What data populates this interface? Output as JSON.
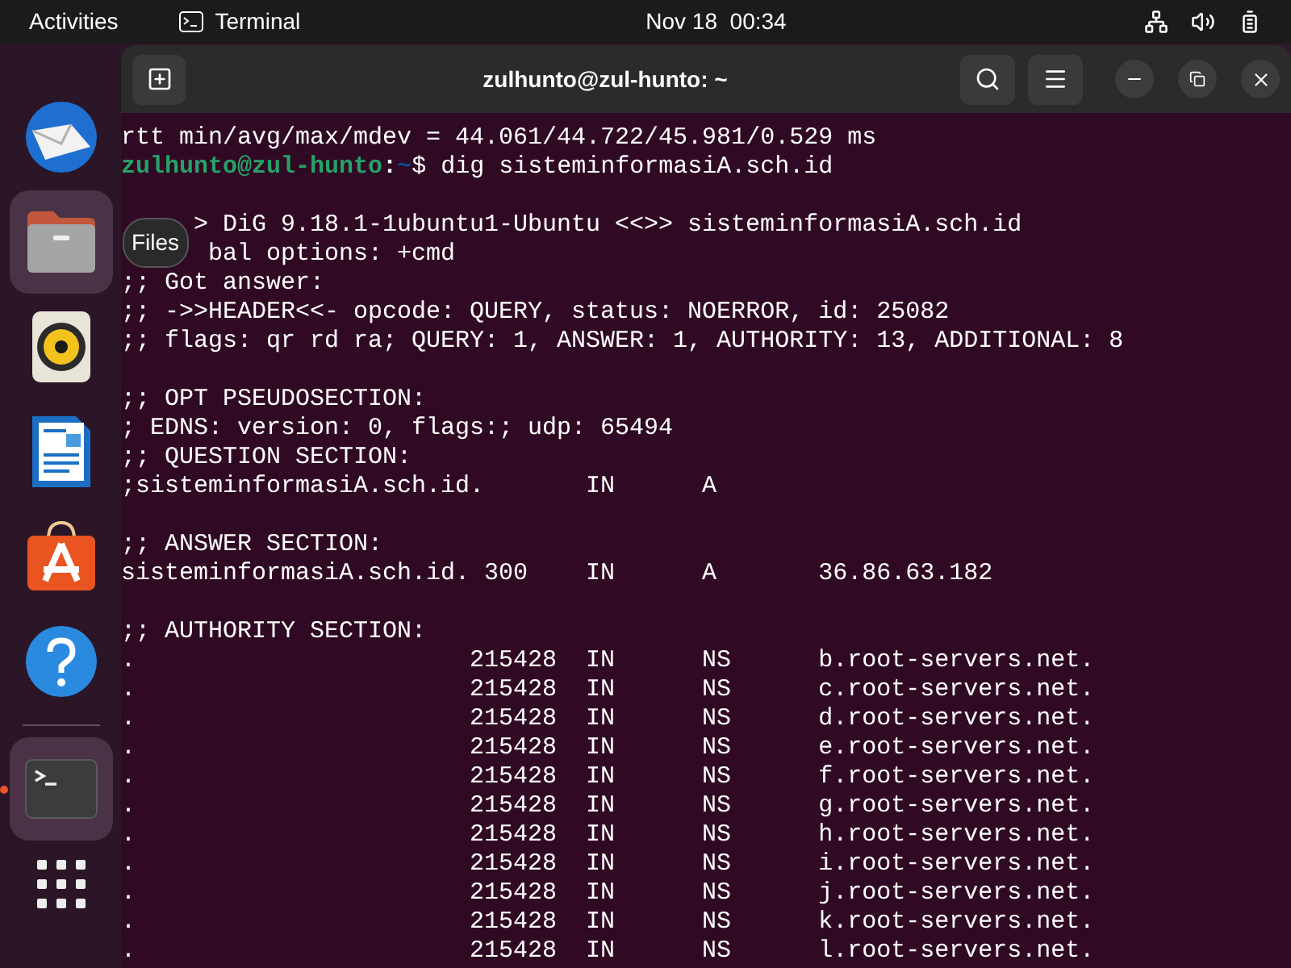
{
  "top_bar": {
    "activities": "Activities",
    "app_name": "Terminal",
    "clock": "Nov 18  00:34"
  },
  "dock": {
    "items": [
      {
        "kind": "mail",
        "running": false,
        "highlighted": false
      },
      {
        "kind": "files",
        "running": false,
        "highlighted": true
      },
      {
        "kind": "music",
        "running": false,
        "highlighted": false
      },
      {
        "kind": "writer",
        "running": false,
        "highlighted": false
      },
      {
        "kind": "store",
        "running": false,
        "highlighted": false
      },
      {
        "kind": "help",
        "running": false,
        "highlighted": false
      },
      {
        "kind": "separator"
      },
      {
        "kind": "terminal",
        "running": true,
        "highlighted": true
      },
      {
        "kind": "apps"
      }
    ],
    "tooltip": "Files"
  },
  "window": {
    "title": "zulhunto@zul-hunto: ~"
  },
  "terminal": {
    "lines": [
      {
        "kind": "output",
        "text": "rtt min/avg/max/mdev = 44.061/44.722/45.981/0.529 ms"
      },
      {
        "kind": "prompt",
        "user_host": "zulhunto@zul-hunto",
        "separator": ":",
        "path": "~",
        "command": "$ dig sisteminformasiA.sch.id"
      },
      {
        "kind": "blank"
      },
      {
        "kind": "covered_short",
        "text": "> DiG 9.18.1-1ubuntu1-Ubuntu <<>> sisteminformasiA.sch.id"
      },
      {
        "kind": "covered_long",
        "text": "bal options: +cmd"
      },
      {
        "kind": "output",
        "text": ";; Got answer:"
      },
      {
        "kind": "output",
        "text": ";; ->>HEADER<<- opcode: QUERY, status: NOERROR, id: 25082"
      },
      {
        "kind": "output",
        "text": ";; flags: qr rd ra; QUERY: 1, ANSWER: 1, AUTHORITY: 13, ADDITIONAL: 8"
      },
      {
        "kind": "blank"
      },
      {
        "kind": "output",
        "text": ";; OPT PSEUDOSECTION:"
      },
      {
        "kind": "output",
        "text": "; EDNS: version: 0, flags:; udp: 65494"
      },
      {
        "kind": "output",
        "text": ";; QUESTION SECTION:"
      },
      {
        "kind": "output",
        "text": ";sisteminformasiA.sch.id.       IN      A"
      },
      {
        "kind": "blank"
      },
      {
        "kind": "output",
        "text": ";; ANSWER SECTION:"
      },
      {
        "kind": "output",
        "text": "sisteminformasiA.sch.id. 300    IN      A       36.86.63.182"
      },
      {
        "kind": "blank"
      },
      {
        "kind": "output",
        "text": ";; AUTHORITY SECTION:"
      },
      {
        "kind": "output",
        "text": ".                       215428  IN      NS      b.root-servers.net."
      },
      {
        "kind": "output",
        "text": ".                       215428  IN      NS      c.root-servers.net."
      },
      {
        "kind": "output",
        "text": ".                       215428  IN      NS      d.root-servers.net."
      },
      {
        "kind": "output",
        "text": ".                       215428  IN      NS      e.root-servers.net."
      },
      {
        "kind": "output",
        "text": ".                       215428  IN      NS      f.root-servers.net."
      },
      {
        "kind": "output",
        "text": ".                       215428  IN      NS      g.root-servers.net."
      },
      {
        "kind": "output",
        "text": ".                       215428  IN      NS      h.root-servers.net."
      },
      {
        "kind": "output",
        "text": ".                       215428  IN      NS      i.root-servers.net."
      },
      {
        "kind": "output",
        "text": ".                       215428  IN      NS      j.root-servers.net."
      },
      {
        "kind": "output",
        "text": ".                       215428  IN      NS      k.root-servers.net."
      },
      {
        "kind": "output",
        "text": ".                       215428  IN      NS      l.root-servers.net."
      }
    ]
  }
}
